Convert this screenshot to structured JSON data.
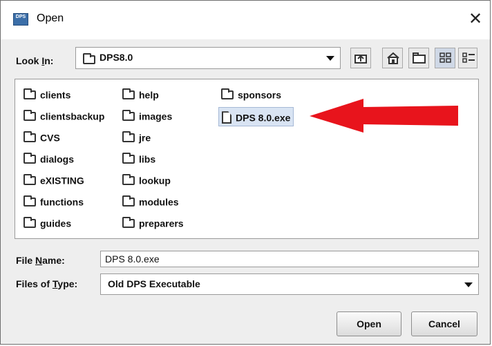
{
  "window": {
    "app_icon": "DPS",
    "title": "Open",
    "close_icon": "close-icon"
  },
  "look_in": {
    "label_prefix": "Look ",
    "label_mnemonic": "I",
    "label_suffix": "n:",
    "value": "DPS8.0"
  },
  "toolbar": {
    "buttons": [
      "up-one-level-icon",
      "home-icon",
      "new-folder-icon",
      "list-view-icon",
      "details-view-icon"
    ]
  },
  "files": {
    "column1": [
      "clients",
      "clientsbackup",
      "CVS",
      "dialogs",
      "eXISTING",
      "functions",
      "guides"
    ],
    "column2": [
      "help",
      "images",
      "jre",
      "libs",
      "lookup",
      "modules",
      "preparers"
    ],
    "column3_folders": [
      "sponsors"
    ],
    "selected_file": "DPS 8.0.exe"
  },
  "annotation": {
    "arrow_color": "#e8141c"
  },
  "file_name": {
    "label_prefix": "File ",
    "label_mnemonic": "N",
    "label_suffix": "ame:",
    "value": "DPS 8.0.exe"
  },
  "file_type": {
    "label_prefix": "Files of ",
    "label_mnemonic": "T",
    "label_suffix": "ype:",
    "value": "Old DPS Executable"
  },
  "buttons": {
    "open": "Open",
    "cancel": "Cancel"
  }
}
